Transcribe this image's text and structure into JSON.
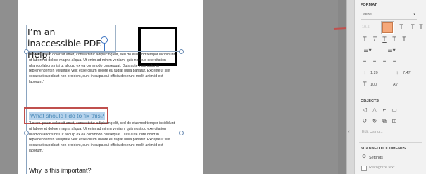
{
  "document": {
    "heading": "I’m an inaccessible PDF. Help!",
    "paragraph_1": "“Lorem ipsum dolor sit amet, consectetur adipiscing elit, sed do eiusmod tempor incididunt ut labore et dolore magna aliqua. Ut enim ad minim veniam, quis nostrud exercitation ullamco laboris nisi ut aliquip ex ea commodo consequat. Duis aute irure dolor in reprehenderit in voluptate velit esse cillum dolore eu fugiat nulla pariatur. Excepteur sint occaecat cupidatat non proident, sunt in culpa qui officia deserunt mollit anim id est laborum.”",
    "subheading": "What should I do to fix this?",
    "paragraph_2": "“Lorem ipsum dolor sit amet, consectetur adipiscing elit, sed do eiusmod tempor incididunt ut labore et dolore magna aliqua. Ut enim ad minim veniam, quis nostrud exercitation ullamco laboris nisi ut aliquip ex ea commodo consequat. Duis aute irure dolor in reprehenderit in voluptate velit esse cillum dolore eu fugiat nulla pariatur. Excepteur sint occaecat cupidatat non proident, sunt in culpa qui officia deserunt mollit anim id est laborum.”",
    "heading_3": "Why is this important?"
  },
  "panel": {
    "format_title": "FORMAT",
    "font_name": "Calibri",
    "font_size": "10.5",
    "line_spacing": "1.20",
    "para_spacing": "7.47",
    "scale": "100",
    "char_spacing_label": "AV",
    "objects_title": "OBJECTS",
    "edit_using": "Edit Using...",
    "scanned_title": "SCANNED DOCUMENTS",
    "settings_label": "Settings",
    "recognize_label": "Recognize text",
    "color_swatch": "#f5a87a"
  },
  "colors": {
    "highlight": "#b7d3ec",
    "callout": "#c0504d"
  }
}
